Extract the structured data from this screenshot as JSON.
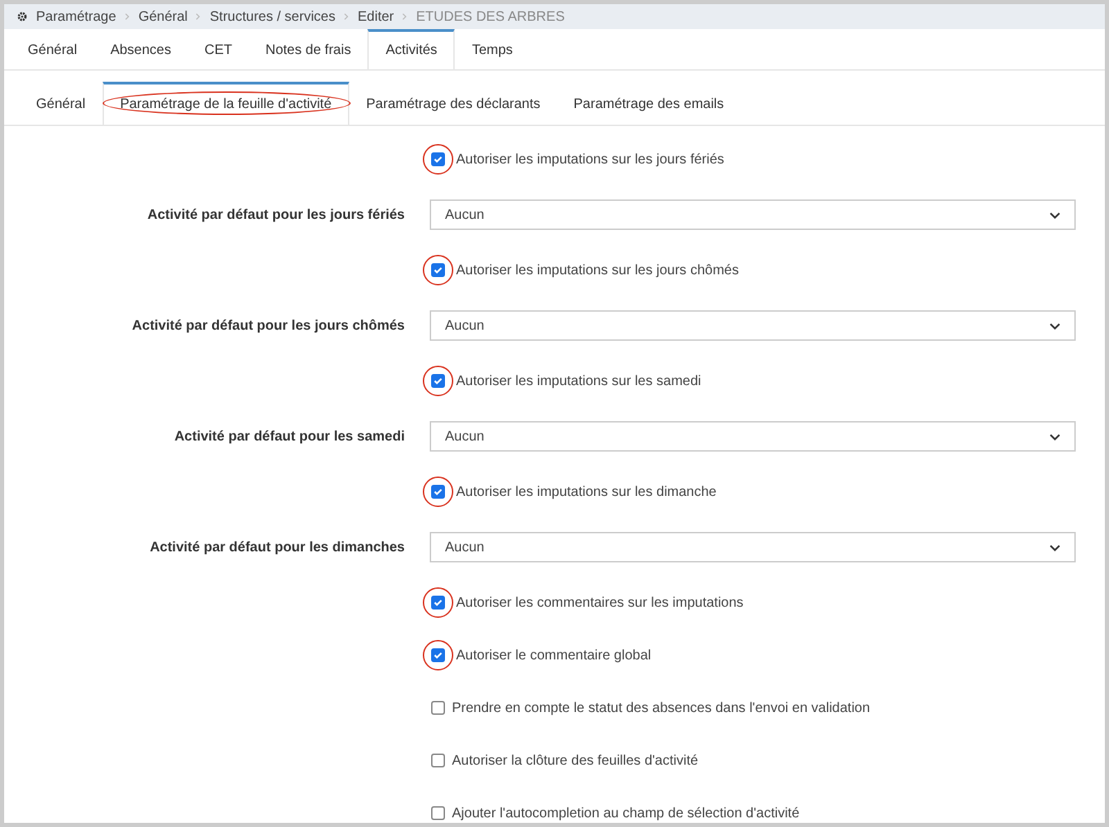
{
  "breadcrumb": [
    {
      "label": "Paramétrage",
      "current": false
    },
    {
      "label": "Général",
      "current": false
    },
    {
      "label": "Structures / services",
      "current": false
    },
    {
      "label": "Editer",
      "current": false
    },
    {
      "label": "ETUDES DES ARBRES",
      "current": true
    }
  ],
  "tabs": [
    {
      "label": "Général",
      "selected": false
    },
    {
      "label": "Absences",
      "selected": false
    },
    {
      "label": "CET",
      "selected": false
    },
    {
      "label": "Notes de frais",
      "selected": false
    },
    {
      "label": "Activités",
      "selected": true
    },
    {
      "label": "Temps",
      "selected": false
    }
  ],
  "subtabs": [
    {
      "label": "Général",
      "selected": false,
      "annotated": false
    },
    {
      "label": "Paramétrage de la feuille d'activité",
      "selected": true,
      "annotated": true
    },
    {
      "label": "Paramétrage des déclarants",
      "selected": false,
      "annotated": false
    },
    {
      "label": "Paramétrage des emails",
      "selected": false,
      "annotated": false
    }
  ],
  "form": [
    {
      "kind": "checkbox",
      "label": "Autoriser les imputations sur les jours fériés",
      "checked": true,
      "annotated": true
    },
    {
      "kind": "select",
      "label": "Activité par défaut pour les jours fériés",
      "value": "Aucun"
    },
    {
      "kind": "checkbox",
      "label": "Autoriser les imputations sur les jours chômés",
      "checked": true,
      "annotated": true
    },
    {
      "kind": "select",
      "label": "Activité par défaut pour les jours chômés",
      "value": "Aucun"
    },
    {
      "kind": "checkbox",
      "label": "Autoriser les imputations sur les samedi",
      "checked": true,
      "annotated": true
    },
    {
      "kind": "select",
      "label": "Activité par défaut pour les samedi",
      "value": "Aucun"
    },
    {
      "kind": "checkbox",
      "label": "Autoriser les imputations sur les dimanche",
      "checked": true,
      "annotated": true
    },
    {
      "kind": "select",
      "label": "Activité par défaut pour les dimanches",
      "value": "Aucun"
    },
    {
      "kind": "checkbox",
      "label": "Autoriser les commentaires sur les imputations",
      "checked": true,
      "annotated": true
    },
    {
      "kind": "checkbox",
      "label": "Autoriser le commentaire global",
      "checked": true,
      "annotated": true
    },
    {
      "kind": "checkbox",
      "label": "Prendre en compte le statut des absences dans l'envoi en validation",
      "checked": false,
      "annotated": false
    },
    {
      "kind": "checkbox",
      "label": "Autoriser la clôture des feuilles d'activité",
      "checked": false,
      "annotated": false
    },
    {
      "kind": "checkbox",
      "label": "Ajouter l'autocompletion au champ de sélection d'activité",
      "checked": false,
      "annotated": false
    }
  ]
}
